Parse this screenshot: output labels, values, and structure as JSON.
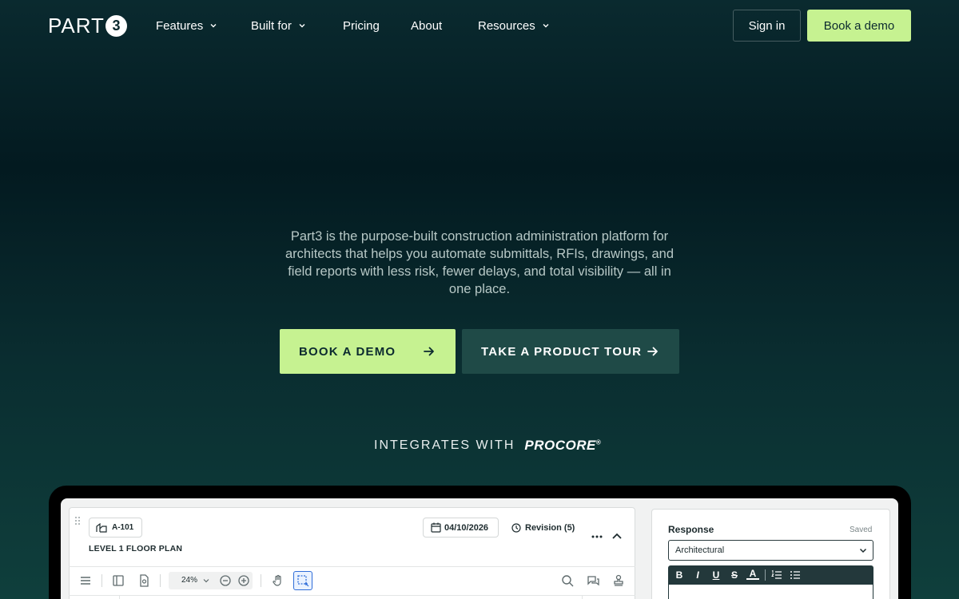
{
  "nav": {
    "logo_text": "PART",
    "logo_badge": "3",
    "items": [
      {
        "label": "Features",
        "has_dropdown": true
      },
      {
        "label": "Built for",
        "has_dropdown": true
      },
      {
        "label": "Pricing",
        "has_dropdown": false
      },
      {
        "label": "About",
        "has_dropdown": false
      },
      {
        "label": "Resources",
        "has_dropdown": true
      }
    ],
    "sign_in": "Sign in",
    "book_demo": "Book a demo"
  },
  "hero": {
    "description": "Part3 is the purpose-built construction administration platform for architects that helps you automate submittals, RFIs, drawings, and field reports with less risk, fewer delays, and total visibility — all in one place.",
    "cta_primary": "BOOK A DEMO",
    "cta_secondary": "TAKE A PRODUCT TOUR"
  },
  "integrations": {
    "label": "INTEGRATES WITH",
    "partner": "PROCORE",
    "partner_mark": "®"
  },
  "app_preview": {
    "sheet_number": "A-101",
    "sheet_title": "LEVEL 1 FLOOR PLAN",
    "date": "04/10/2026",
    "revision": "Revision (5)",
    "zoom": "24%",
    "response": {
      "title": "Response",
      "status": "Saved",
      "discipline": "Architectural"
    },
    "editor_tools": [
      "B",
      "I",
      "U",
      "S",
      "A"
    ]
  },
  "colors": {
    "accent": "#c6f291",
    "background_dark": "#031a20",
    "secondary_button": "#1f4a47"
  }
}
